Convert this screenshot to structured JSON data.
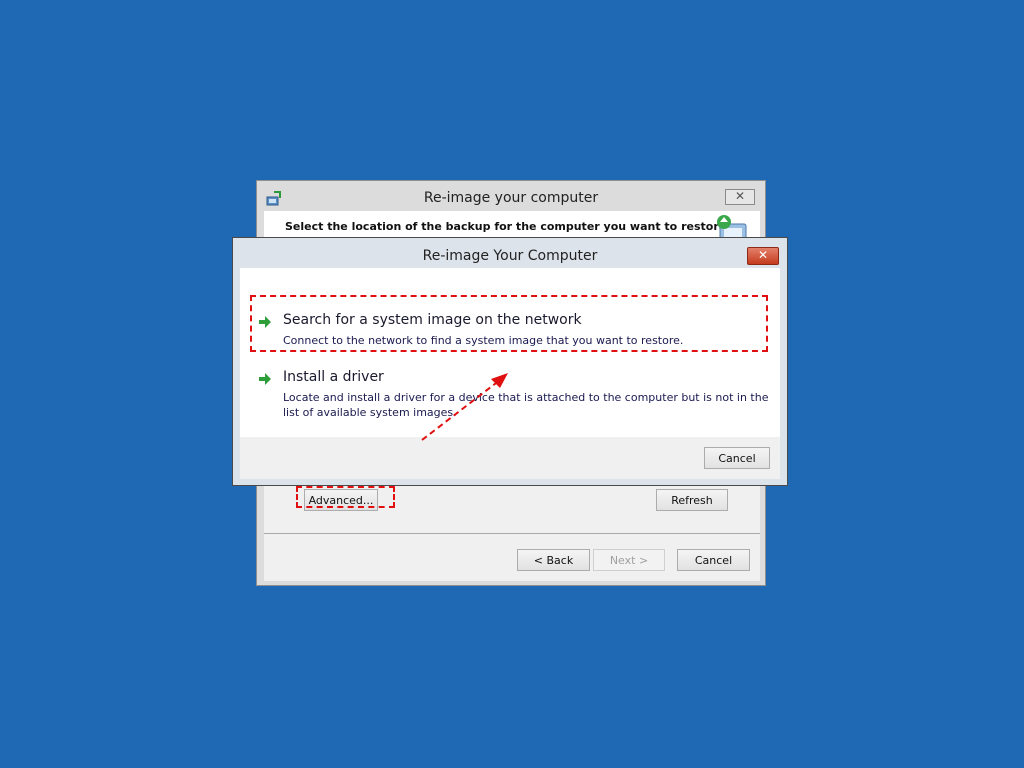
{
  "background_color": "#1f68b3",
  "accent_color": "#e01010",
  "back_window": {
    "title": "Re-image your computer",
    "instruction": "Select the location of the backup for the computer you want to restore",
    "icons": [
      "system-restore-app-icon",
      "restore-computer-icon",
      "close-icon"
    ],
    "buttons": {
      "advanced": "Advanced...",
      "refresh": "Refresh",
      "back": "< Back",
      "next": "Next >",
      "cancel": "Cancel"
    }
  },
  "dialog": {
    "title": "Re-image Your Computer",
    "options": [
      {
        "title": "Search for a system image on the network",
        "description": "Connect to the network to find a system image that you want to restore.",
        "icon": "green-arrow-icon"
      },
      {
        "title": "Install a driver",
        "description": "Locate and install a driver for a device that is attached to the computer but is not in the list of available system images.",
        "icon": "green-arrow-icon"
      }
    ],
    "cancel": "Cancel"
  }
}
